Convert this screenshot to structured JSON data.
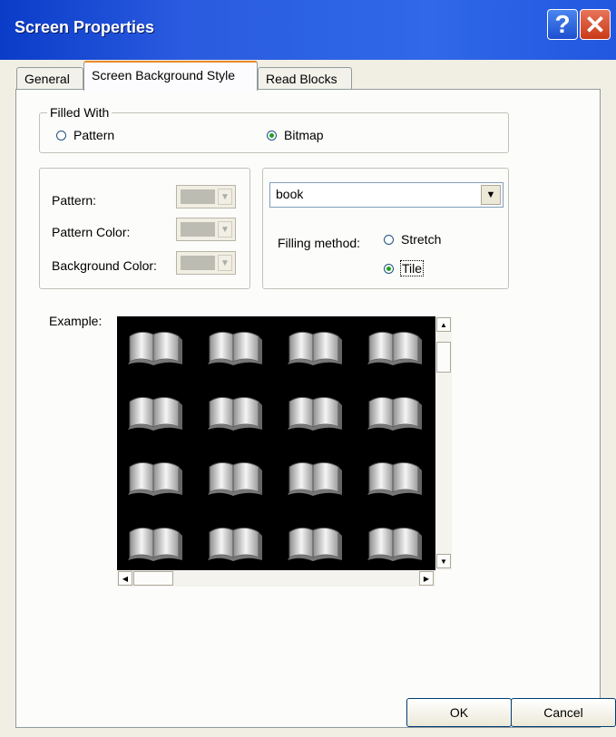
{
  "window": {
    "title": "Screen Properties"
  },
  "titlebar": {
    "help_label": "?",
    "close_label": "✕"
  },
  "tabs": [
    {
      "label": "General"
    },
    {
      "label": "Screen Background Style"
    },
    {
      "label": "Read Blocks"
    }
  ],
  "filled_with": {
    "title": "Filled With",
    "options": [
      "Pattern",
      "Bitmap"
    ],
    "selected": "Bitmap"
  },
  "pattern_panel": {
    "pattern_label": "Pattern:",
    "pattern_color_label": "Pattern Color:",
    "background_color_label": "Background Color:"
  },
  "bitmap_panel": {
    "selected_bitmap": "book",
    "filling_method_label": "Filling method:",
    "options": [
      "Stretch",
      "Tile"
    ],
    "selected": "Tile"
  },
  "example": {
    "label": "Example:"
  },
  "buttons": {
    "ok": "OK",
    "cancel": "Cancel"
  },
  "colors": {
    "titlebar": "#2a5be0",
    "dialog_bg": "#f1efe4",
    "example_bg": "#000000"
  }
}
